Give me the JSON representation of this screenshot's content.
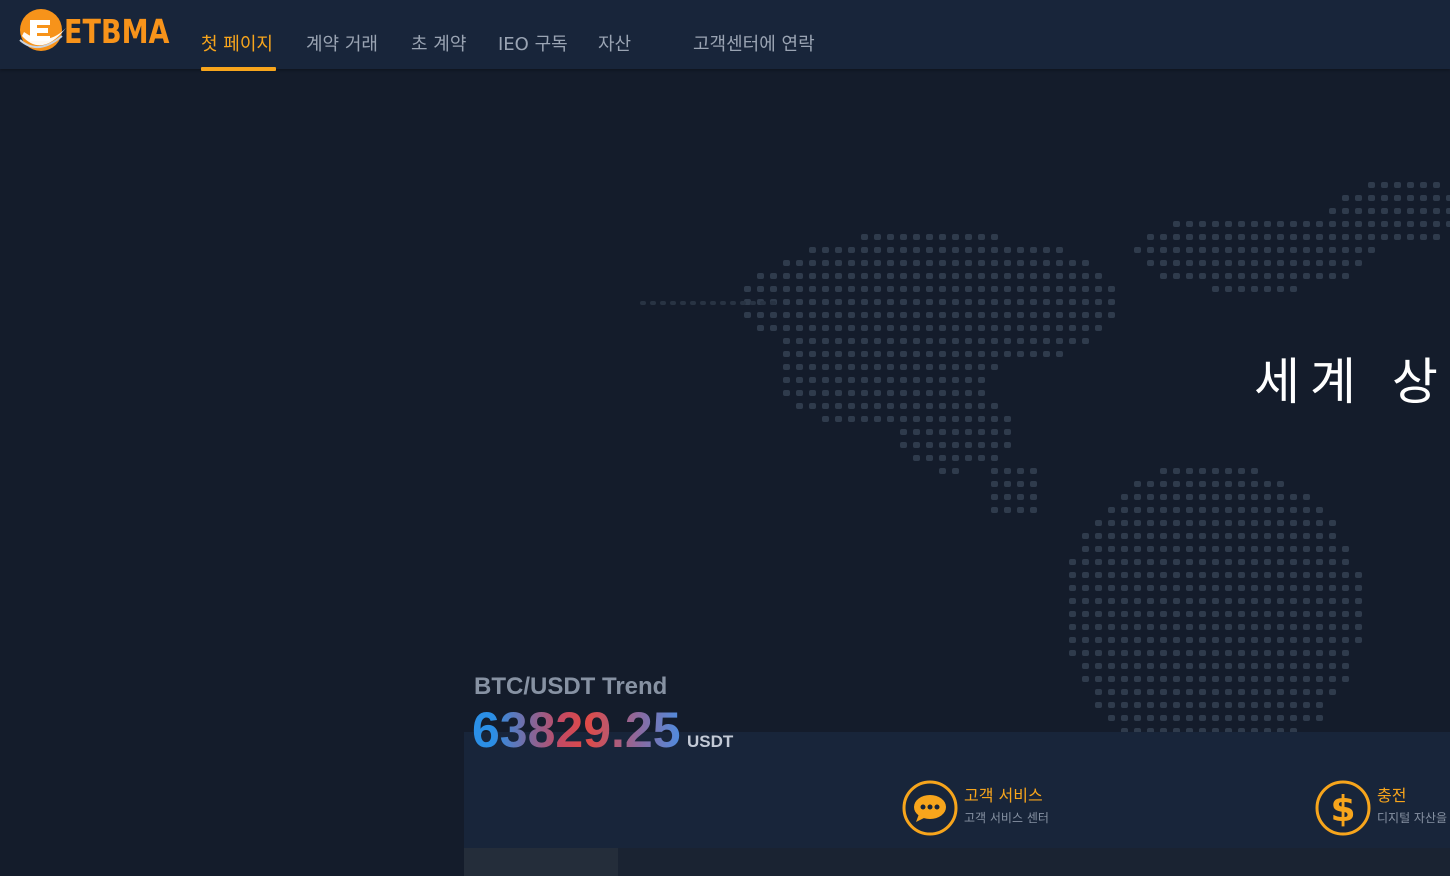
{
  "header": {
    "logo_text": "ETBMA",
    "nav": [
      {
        "label": "첫 페이지",
        "active": true
      },
      {
        "label": "계약 거래"
      },
      {
        "label": "초 계약"
      },
      {
        "label": "IEO 구독"
      },
      {
        "label": "자산"
      },
      {
        "label": "고객센터에 연락"
      }
    ]
  },
  "hero": {
    "headline": "세계 상위"
  },
  "trend": {
    "title": "BTC/USDT Trend",
    "price": "63829.25",
    "unit": "USDT"
  },
  "services": [
    {
      "title": "고객 서비스",
      "subtitle": "고객 서비스 센터",
      "icon": "chat-bubble-icon"
    },
    {
      "title": "충전",
      "subtitle": "디지털 자산을",
      "icon": "dollar-icon"
    }
  ],
  "colors": {
    "accent": "#f7a51c",
    "background": "#141c2b",
    "header": "#18253a",
    "nav_text": "#9aa4b3",
    "map_dot": "#2f3b4c"
  }
}
